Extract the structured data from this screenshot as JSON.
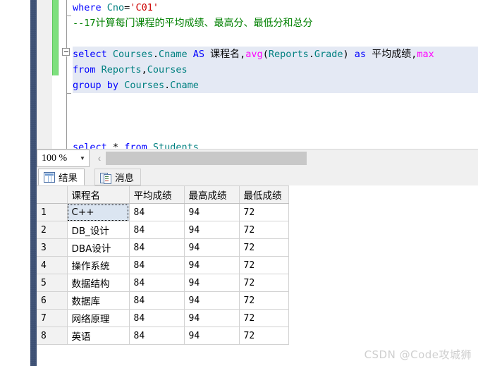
{
  "editor": {
    "zoom_level": "100 %",
    "zoom_dropdown_icon": "chevron-down-icon",
    "scroll_left_icon": "chevron-left-icon",
    "fold_icon": "collapse-minus-icon",
    "lines": [
      {
        "id": "line-where",
        "tokens": [
          {
            "t": "where",
            "c": "kw"
          },
          {
            "t": " ",
            "c": "pl"
          },
          {
            "t": "Cno",
            "c": "id"
          },
          {
            "t": "=",
            "c": "op"
          },
          {
            "t": "'C01'",
            "c": "str"
          }
        ]
      },
      {
        "id": "line-comment",
        "tokens": [
          {
            "t": "--17",
            "c": "cm"
          },
          {
            "t": "计算每门课程的平均成绩、最高分、最低分和总分",
            "c": "cmn"
          }
        ]
      },
      {
        "id": "line-blank-1",
        "tokens": []
      },
      {
        "id": "line-select",
        "selected": true,
        "tokens": [
          {
            "t": "select",
            "c": "kw"
          },
          {
            "t": " ",
            "c": "pl"
          },
          {
            "t": "Courses",
            "c": "id"
          },
          {
            "t": ".",
            "c": "op"
          },
          {
            "t": "Cname",
            "c": "id"
          },
          {
            "t": " ",
            "c": "pl"
          },
          {
            "t": "AS",
            "c": "kw"
          },
          {
            "t": " ",
            "c": "pl"
          },
          {
            "t": "课程名",
            "c": "cn"
          },
          {
            "t": ",",
            "c": "op"
          },
          {
            "t": "avg",
            "c": "fn"
          },
          {
            "t": "(",
            "c": "op"
          },
          {
            "t": "Reports",
            "c": "id"
          },
          {
            "t": ".",
            "c": "op"
          },
          {
            "t": "Grade",
            "c": "id"
          },
          {
            "t": ")",
            "c": "op"
          },
          {
            "t": " ",
            "c": "pl"
          },
          {
            "t": "as",
            "c": "kw"
          },
          {
            "t": " ",
            "c": "pl"
          },
          {
            "t": "平均成绩",
            "c": "cn"
          },
          {
            "t": ",",
            "c": "op"
          },
          {
            "t": "max",
            "c": "fn"
          }
        ]
      },
      {
        "id": "line-from",
        "selected": true,
        "tokens": [
          {
            "t": "from",
            "c": "kw"
          },
          {
            "t": " ",
            "c": "pl"
          },
          {
            "t": "Reports",
            "c": "id"
          },
          {
            "t": ",",
            "c": "op"
          },
          {
            "t": "Courses",
            "c": "id"
          }
        ]
      },
      {
        "id": "line-groupby",
        "selected": true,
        "tokens": [
          {
            "t": "group",
            "c": "kw"
          },
          {
            "t": " ",
            "c": "pl"
          },
          {
            "t": "by",
            "c": "kw"
          },
          {
            "t": " ",
            "c": "pl"
          },
          {
            "t": "Courses",
            "c": "id"
          },
          {
            "t": ".",
            "c": "op"
          },
          {
            "t": "Cname",
            "c": "id"
          }
        ]
      },
      {
        "id": "line-blank-2",
        "tokens": []
      },
      {
        "id": "line-blank-3",
        "tokens": []
      },
      {
        "id": "line-blank-4",
        "tokens": []
      },
      {
        "id": "line-select2",
        "tokens": [
          {
            "t": "select",
            "c": "kw"
          },
          {
            "t": " ",
            "c": "pl"
          },
          {
            "t": "*",
            "c": "op"
          },
          {
            "t": " ",
            "c": "pl"
          },
          {
            "t": "from",
            "c": "kw"
          },
          {
            "t": " ",
            "c": "pl"
          },
          {
            "t": "Students",
            "c": "id"
          }
        ]
      }
    ],
    "colors": {
      "keyword": "#0000ff",
      "identifier": "#008080",
      "string": "#cc0000",
      "comment": "#008000",
      "function": "#ff00ff",
      "selection": "#e4e9f4",
      "change_bar": "#7ee07e"
    }
  },
  "tabs": [
    {
      "id": "tab-results",
      "label": "结果",
      "icon": "grid-icon",
      "active": true
    },
    {
      "id": "tab-messages",
      "label": "消息",
      "icon": "message-icon",
      "active": false
    }
  ],
  "results_grid": {
    "row_number_header": "",
    "columns": [
      "课程名",
      "平均成绩",
      "最高成绩",
      "最低成绩"
    ],
    "rows": [
      {
        "n": "1",
        "name": "C++",
        "avg": "84",
        "max": "94",
        "min": "72",
        "focused": true
      },
      {
        "n": "2",
        "name": "DB_设计",
        "avg": "84",
        "max": "94",
        "min": "72",
        "focused": false
      },
      {
        "n": "3",
        "name": "DBA设计",
        "avg": "84",
        "max": "94",
        "min": "72",
        "focused": false
      },
      {
        "n": "4",
        "name": "操作系统",
        "avg": "84",
        "max": "94",
        "min": "72",
        "focused": false
      },
      {
        "n": "5",
        "name": "数据结构",
        "avg": "84",
        "max": "94",
        "min": "72",
        "focused": false
      },
      {
        "n": "6",
        "name": "数据库",
        "avg": "84",
        "max": "94",
        "min": "72",
        "focused": false
      },
      {
        "n": "7",
        "name": "网络原理",
        "avg": "84",
        "max": "94",
        "min": "72",
        "focused": false
      },
      {
        "n": "8",
        "name": "英语",
        "avg": "84",
        "max": "94",
        "min": "72",
        "focused": false
      }
    ]
  },
  "watermark": "CSDN @Code攻城狮"
}
